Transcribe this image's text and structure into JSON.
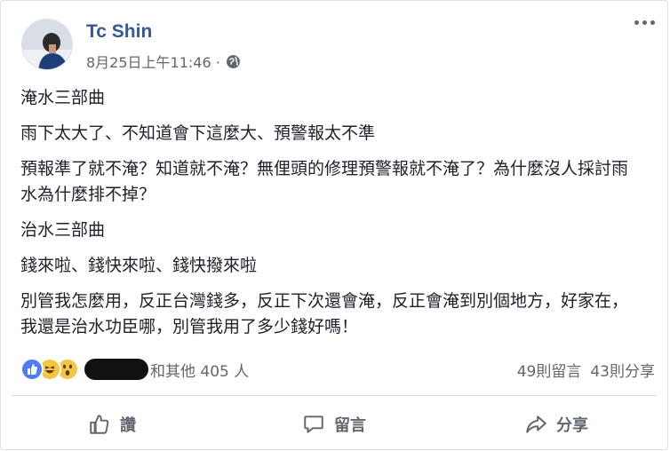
{
  "post": {
    "author": "Tc Shin",
    "timestamp": "8月25日上午11:46 ·",
    "privacy_icon": "globe-icon",
    "paragraphs": [
      "淹水三部曲",
      "雨下太大了、不知道會下這麼大、預警報太不準",
      "預報準了就不淹？知道就不淹？無俚頭的修理預警報就不淹了？為什麼沒人採討雨水為什麼排不掉？",
      "治水三部曲",
      "錢來啦、錢快來啦、錢快撥來啦",
      "別管我怎麼用，反正台灣錢多，反正下次還會淹，反正會淹到別個地方，好家在，我還是治水功臣哪，別管我用了多少錢好嗎！"
    ]
  },
  "reactions": {
    "types": [
      "like-icon",
      "haha-icon",
      "wow-icon"
    ],
    "summary": "和其他 405 人",
    "comments": "49則留言",
    "shares": "43則分享"
  },
  "actions": {
    "like": "讚",
    "comment": "留言",
    "share": "分享"
  },
  "colors": {
    "author": "#365899",
    "meta": "#616770",
    "like_blue": "#4f7bf5",
    "emoji_yellow": "#f7c544"
  }
}
